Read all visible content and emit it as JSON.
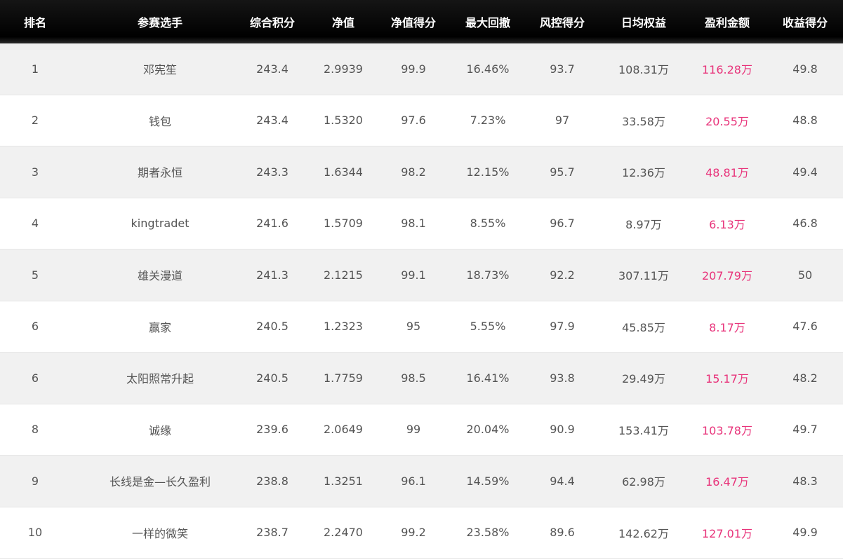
{
  "headers": [
    "排名",
    "参赛选手",
    "综合积分",
    "净值",
    "净值得分",
    "最大回撤",
    "风控得分",
    "日均权益",
    "盈利金额",
    "收益得分"
  ],
  "rows": [
    [
      "1",
      "邓宪笙",
      "243.4",
      "2.9939",
      "99.9",
      "16.46%",
      "93.7",
      "108.31万",
      "116.28万",
      "49.8"
    ],
    [
      "2",
      "钱包",
      "243.4",
      "1.5320",
      "97.6",
      "7.23%",
      "97",
      "33.58万",
      "20.55万",
      "48.8"
    ],
    [
      "3",
      "期者永恒",
      "243.3",
      "1.6344",
      "98.2",
      "12.15%",
      "95.7",
      "12.36万",
      "48.81万",
      "49.4"
    ],
    [
      "4",
      "kingtradet",
      "241.6",
      "1.5709",
      "98.1",
      "8.55%",
      "96.7",
      "8.97万",
      "6.13万",
      "46.8"
    ],
    [
      "5",
      "雄关漫道",
      "241.3",
      "2.1215",
      "99.1",
      "18.73%",
      "92.2",
      "307.11万",
      "207.79万",
      "50"
    ],
    [
      "6",
      "赢家",
      "240.5",
      "1.2323",
      "95",
      "5.55%",
      "97.9",
      "45.85万",
      "8.17万",
      "47.6"
    ],
    [
      "6",
      "太阳照常升起",
      "240.5",
      "1.7759",
      "98.5",
      "16.41%",
      "93.8",
      "29.49万",
      "15.17万",
      "48.2"
    ],
    [
      "8",
      "诚缘",
      "239.6",
      "2.0649",
      "99",
      "20.04%",
      "90.9",
      "153.41万",
      "103.78万",
      "49.7"
    ],
    [
      "9",
      "长线是金—长久盈利",
      "238.8",
      "1.3251",
      "96.1",
      "14.59%",
      "94.4",
      "62.98万",
      "16.47万",
      "48.3"
    ],
    [
      "10",
      "一样的微笑",
      "238.7",
      "2.2470",
      "99.2",
      "23.58%",
      "89.6",
      "142.62万",
      "127.01万",
      "49.9"
    ]
  ],
  "colors": {
    "header_bg": "#000000",
    "header_text": "#ffffff",
    "row_odd_bg": "#f1f1f1",
    "row_even_bg": "#ffffff",
    "text": "#555555",
    "profit": "#e8337a"
  }
}
